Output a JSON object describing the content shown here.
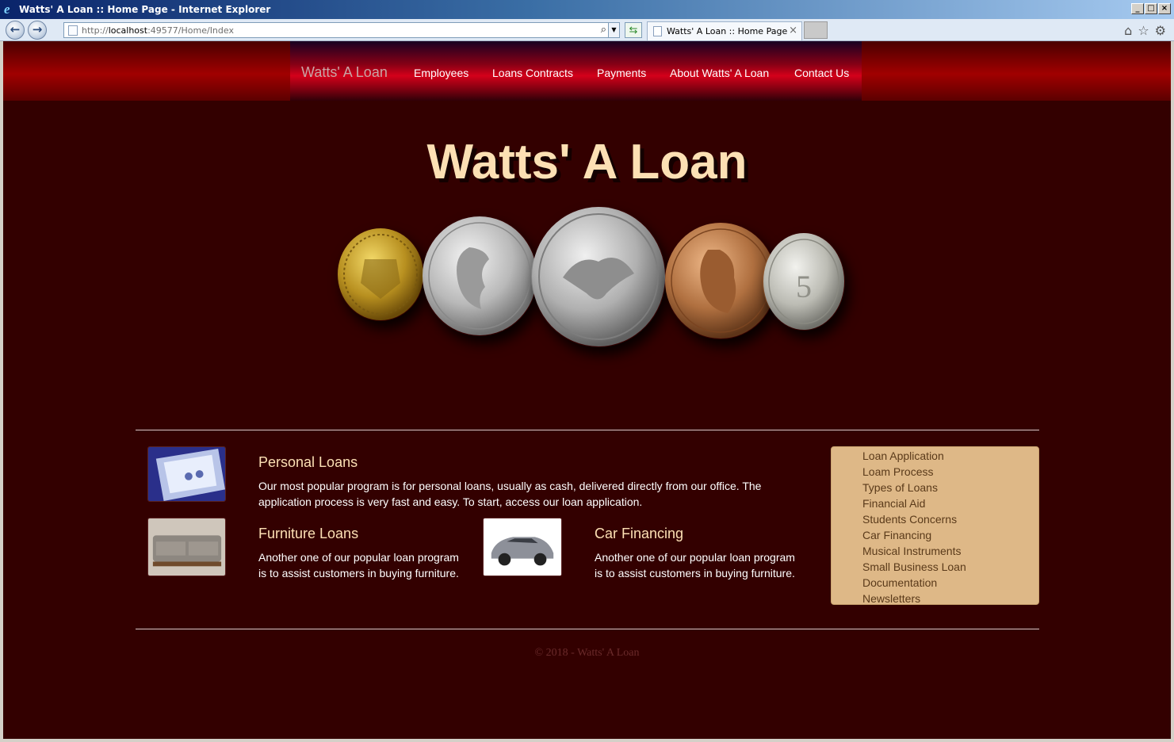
{
  "window": {
    "title": "Watts' A Loan :: Home Page - Internet Explorer",
    "controls": [
      "_",
      "□",
      "×"
    ]
  },
  "browser": {
    "url_prefix": "http://",
    "url_host": "localhost",
    "url_rest": ":49577/Home/Index",
    "tab_title": "Watts' A Loan :: Home Page",
    "tab_close": "×",
    "back_icon": "←",
    "forward_icon": "→",
    "refresh_icon": "⇆",
    "tools": [
      "⌂",
      "☆",
      "⚙"
    ]
  },
  "nav": {
    "brand": "Watts' A Loan",
    "items": [
      "Employees",
      "Loans Contracts",
      "Payments",
      "About Watts' A Loan",
      "Contact Us"
    ]
  },
  "hero": {
    "title": "Watts' A Loan"
  },
  "sections": {
    "personal": {
      "title": "Personal Loans",
      "text": "Our most popular program is for personal loans, usually as cash, delivered directly from our office. The application process is very fast and easy. To start, access our loan application."
    },
    "furniture": {
      "title": "Furniture Loans",
      "text": "Another one of our popular loan program is to assist customers in buying furniture."
    },
    "car": {
      "title": "Car Financing",
      "text": "Another one of our popular loan program is to assist customers in buying furniture."
    }
  },
  "sidebar": {
    "links": [
      "Loan Application",
      "Loam Process",
      "Types of Loans",
      "Financial Aid",
      "Students Concerns",
      "Car Financing",
      "Musical Instruments",
      "Small Business Loan",
      "Documentation",
      "Newsletters"
    ]
  },
  "footer": {
    "text": "© 2018 - Watts' A Loan"
  },
  "colors": {
    "page_bg": "#330000",
    "heading": "#fce0b4",
    "sidebar_bg": "#deb887",
    "nav_red": "#d4001a"
  }
}
